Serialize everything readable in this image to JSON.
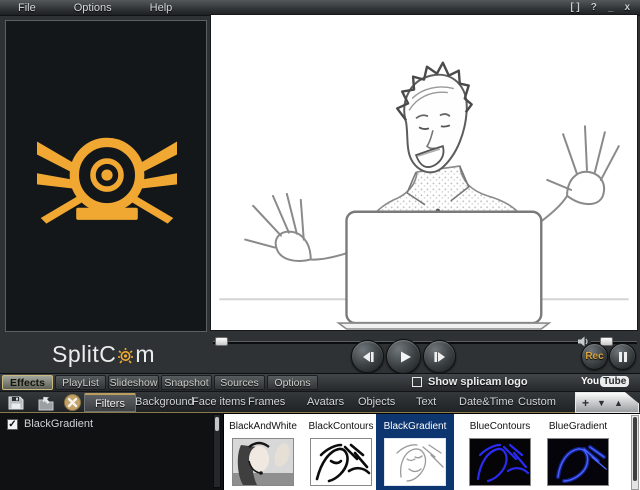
{
  "menu": {
    "items": [
      "File",
      "Options",
      "Help"
    ]
  },
  "window_controls": {
    "maximize": "[ ]",
    "help": "?",
    "minimize": "_",
    "close": "x"
  },
  "branding": {
    "wordmark_pre": "SplitC",
    "wordmark_post": "m",
    "accent_orange": "#f0a832"
  },
  "transport": {
    "rec_label": "Rec"
  },
  "main_tabs": [
    {
      "label": "Effects",
      "selected": true
    },
    {
      "label": "PlayList",
      "selected": false
    },
    {
      "label": "Slideshow",
      "selected": false
    },
    {
      "label": "Snapshot",
      "selected": false
    },
    {
      "label": "Sources",
      "selected": false
    },
    {
      "label": "Options",
      "selected": false
    }
  ],
  "show_logo_checkbox": {
    "label": "Show splicam logo",
    "checked": false
  },
  "youtube_badge": {
    "part1": "You",
    "part2": "Tube"
  },
  "filter_tabs": [
    {
      "label": "Filters",
      "selected": true
    },
    {
      "label": "Background",
      "selected": false
    },
    {
      "label": "Face items",
      "selected": false
    },
    {
      "label": "Frames",
      "selected": false
    },
    {
      "label": "Avatars",
      "selected": false
    },
    {
      "label": "Objects",
      "selected": false
    },
    {
      "label": "Text",
      "selected": false
    },
    {
      "label": "Date&Time",
      "selected": false
    },
    {
      "label": "Custom",
      "selected": false
    }
  ],
  "tab_tools": {
    "add": "+",
    "move_down": "▼",
    "move_up": "▲"
  },
  "filters_list": [
    {
      "label": "BlackGradient",
      "checked": true,
      "checkmark": "✓"
    }
  ],
  "thumbnails": [
    {
      "label": "BlackAndWhite",
      "selected": false
    },
    {
      "label": "BlackContours",
      "selected": false
    },
    {
      "label": "BlackGradient",
      "selected": true
    },
    {
      "label": "BlueContours",
      "selected": false
    },
    {
      "label": "BlueGradient",
      "selected": false
    }
  ],
  "colors": {
    "selection_blue": "#0d3570",
    "accent_orange": "#f0a832",
    "contour_blue": "#2a2af0"
  }
}
